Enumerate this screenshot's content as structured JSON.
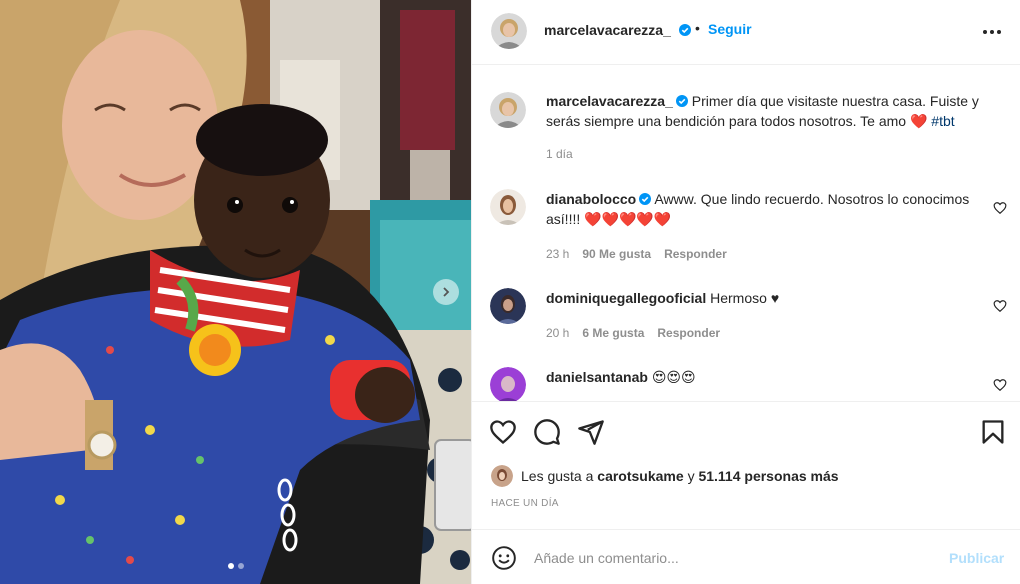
{
  "post": {
    "username": "marcelavacarezza_",
    "follow_label": "Seguir",
    "separator": "•",
    "caption": "Primer día que visitaste nuestra casa. Fuiste y serás siempre una bendición para todos nosotros. Te amo",
    "caption_heart": "❤️",
    "hashtag": "#tbt",
    "caption_age": "1 día",
    "photo_count": 2,
    "active_photo": 1
  },
  "comments": [
    {
      "username": "dianabolocco",
      "verified": true,
      "text": "Awww. Que lindo recuerdo. Nosotros lo conocimos así!!!!",
      "emoji": "❤️❤️❤️❤️❤️",
      "age": "23 h",
      "likes": "90 Me gusta",
      "reply": "Responder"
    },
    {
      "username": "dominiquegallegooficial",
      "verified": false,
      "text": "Hermoso",
      "emoji": "♥",
      "age": "20 h",
      "likes": "6 Me gusta",
      "reply": "Responder"
    },
    {
      "username": "danielsantanab",
      "verified": false,
      "text": "",
      "emoji": "😍😍😍"
    }
  ],
  "likes_line": {
    "prefix": "Les gusta a",
    "user": "carotsukame",
    "middle": "y",
    "count": "51.114 personas más"
  },
  "time_ago": "HACE UN DÍA",
  "composer": {
    "placeholder": "Añade un comentario...",
    "publish_label": "Publicar"
  },
  "colors": {
    "link_blue": "#0095f6",
    "publish_disabled": "#b2dffc",
    "muted": "#8e8e8e",
    "text": "#262626",
    "heart_red": "#ed4956"
  }
}
